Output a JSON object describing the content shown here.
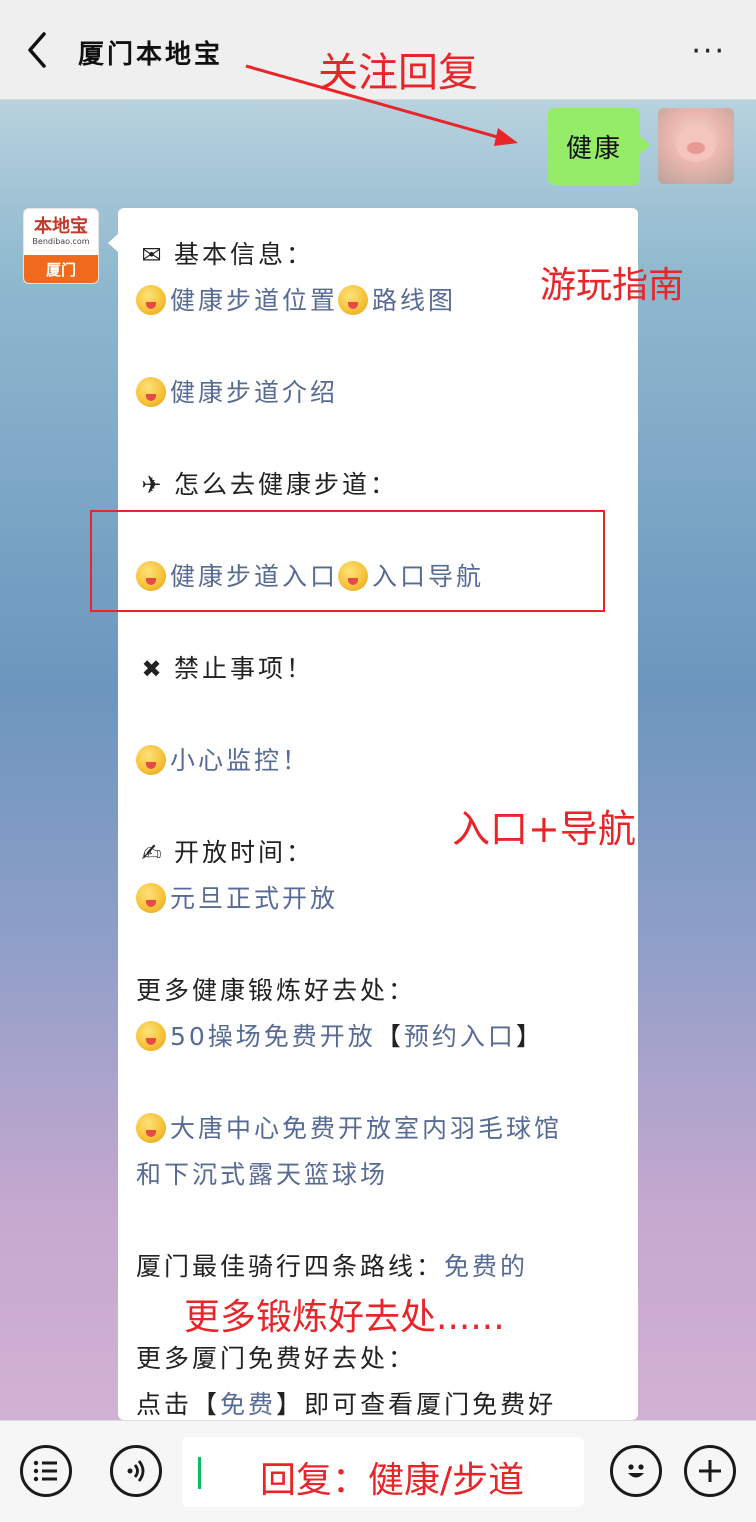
{
  "header": {
    "title": "厦门本地宝",
    "back_icon": "chevron-left-icon",
    "more_label": "···"
  },
  "annotations": {
    "follow_reply": "关注回复",
    "tour_guide": "游玩指南",
    "entry_nav": "入口+导航",
    "more_places": "更多锻炼好去处......",
    "input_hint": "回复：健康/步道",
    "color": "#e8262a"
  },
  "sent_message": {
    "text": "健康"
  },
  "official_account": {
    "logo_text": "本地宝",
    "logo_domain": "Bendibao.com",
    "logo_city": "厦门",
    "accent": "#f06a1b"
  },
  "reply": {
    "basic_info_heading": "基本信息：",
    "location_link": "健康步道位置",
    "route_link": "路线图",
    "intro_link": "健康步道介绍",
    "how_to_go_heading": "怎么去健康步道：",
    "entrance_link": "健康步道入口",
    "entrance_nav_link": "入口导航",
    "prohibited_heading": "禁止事项！",
    "monitor_link": "小心监控！",
    "hours_heading": "开放时间：",
    "hours_link": "元旦正式开放",
    "more_exercise_heading": "更多健康锻炼好去处：",
    "field_link": "50操场免费开放",
    "bracket_open": "【",
    "booking_link": "预约入口",
    "bracket_close": "】",
    "datang_line1": "大唐中心免费开放室内羽毛球馆",
    "datang_line2": "和下沉式露天篮球场",
    "cycling_prefix": "厦门最佳骑行四条路线：",
    "cycling_link": "免费的",
    "more_free_heading": "更多厦门免费好去处：",
    "click_prefix": "点击",
    "free_link": "免费",
    "click_suffix": "即可查看厦门免费好"
  },
  "bottom_bar": {
    "menu_icon": "list-icon",
    "voice_icon": "voice-icon",
    "emoji_icon": "smile-icon",
    "plus_icon": "plus-icon",
    "cursor_color": "#07c160"
  },
  "colors": {
    "sent_bubble": "#95ec69",
    "link": "#576b95",
    "header_bg": "#efefef"
  }
}
